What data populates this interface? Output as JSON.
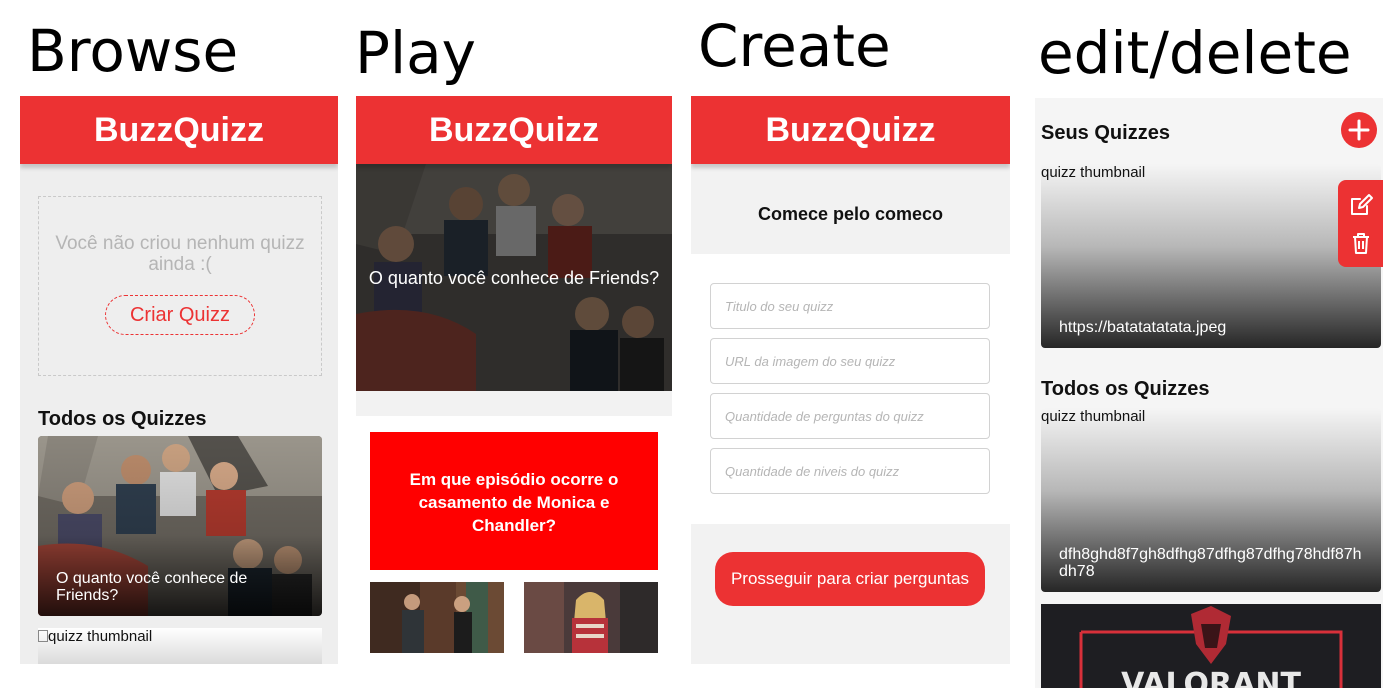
{
  "sections": {
    "browse": "Browse",
    "play": "Play",
    "create": "Create",
    "edit": "edit/delete"
  },
  "app": {
    "name": "BuzzQuizz"
  },
  "browse": {
    "empty_message": "Você não criou nenhum quizz ainda :(",
    "create_button": "Criar Quizz",
    "all_heading": "Todos os Quizzes",
    "card_title": "O quanto você conhece de Friends?",
    "thumb_alt": "quizz thumbnail"
  },
  "play": {
    "banner_title": "O quanto você conhece de Friends?",
    "question": "Em que episódio ocorre o casamento de Monica e Chandler?"
  },
  "create": {
    "subtitle": "Comece pelo comeco",
    "fields": {
      "title": "Titulo do seu quizz",
      "url": "URL da imagem do seu quizz",
      "questions": "Quantidade de perguntas do quizz",
      "levels": "Quantidade de niveis do quizz"
    },
    "proceed_button": "Prosseguir para criar perguntas"
  },
  "edit": {
    "your_heading": "Seus Quizzes",
    "all_heading": "Todos os Quizzes",
    "thumb_alt": "quizz thumbnail",
    "card1_url": "https://batatatatata.jpeg",
    "card2_url": "dfh8ghd8f7gh8dfhg87dfhg87dfhg78hdf87hdh78",
    "valorant_text": "VALORANT"
  },
  "colors": {
    "brand": "#ec3233",
    "question_bg": "#ff0000"
  },
  "icons": [
    "plus-icon",
    "edit-icon",
    "trash-icon"
  ]
}
